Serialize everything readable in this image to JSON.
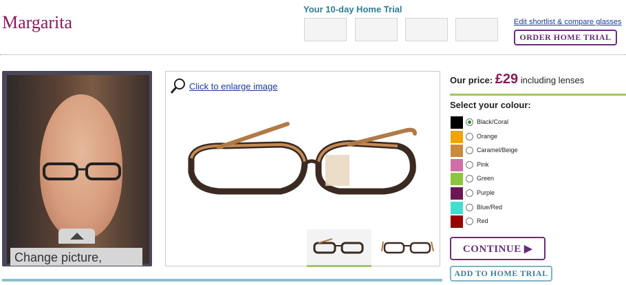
{
  "product": {
    "title": "Margarita"
  },
  "trial": {
    "title": "Your 10-day Home Trial",
    "compare_link": "Edit shortlist & compare glasses",
    "order_button": "ORDER HOME TRIAL"
  },
  "photo": {
    "change_label": "Change picture,"
  },
  "image": {
    "enlarge_link": "Click to enlarge image",
    "active_thumbnail": 1
  },
  "price": {
    "label": "Our price:",
    "amount": "£29",
    "suffix": "including lenses"
  },
  "colours": {
    "heading": "Select your colour:",
    "selected": "Black/Coral",
    "options": [
      {
        "label": "Black/Coral",
        "color": "#000000"
      },
      {
        "label": "Orange",
        "color": "#f4a300"
      },
      {
        "label": "Caramel/Beige",
        "color": "#c98a3e"
      },
      {
        "label": "Pink",
        "color": "#d06fa6"
      },
      {
        "label": "Green",
        "color": "#8cc63f"
      },
      {
        "label": "Purple",
        "color": "#6b1756"
      },
      {
        "label": "Blue/Red",
        "color": "#40e0d0"
      },
      {
        "label": "Red",
        "color": "#990000"
      }
    ]
  },
  "actions": {
    "continue": "CONTINUE ▶",
    "add_trial": "ADD TO HOME TRIAL"
  },
  "theme": {
    "accent": "#8a1a5c",
    "button_border": "#6a2c7a",
    "trial_color": "#2e7f93",
    "green_rule": "#a4c36a"
  }
}
